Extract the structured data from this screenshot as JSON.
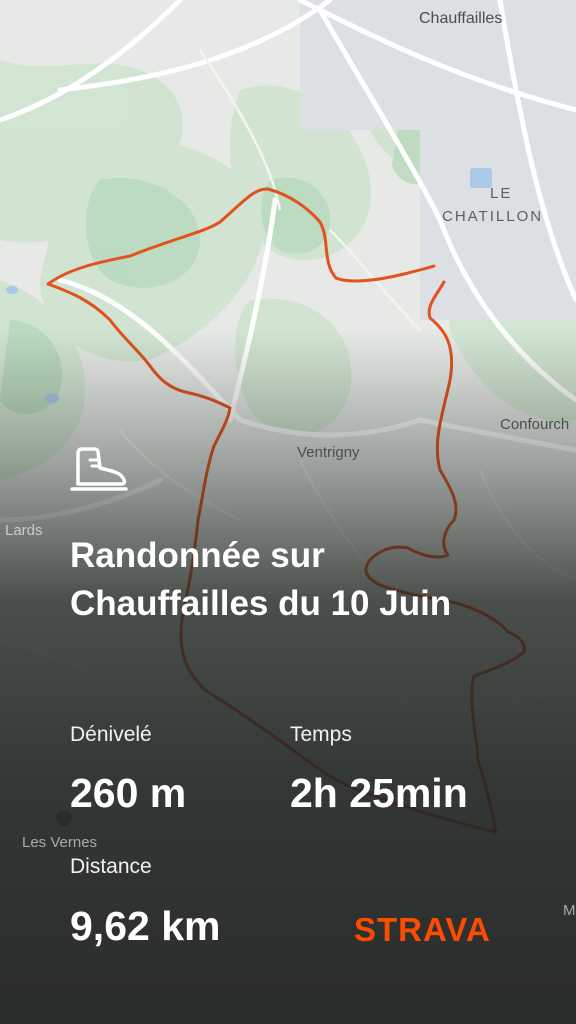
{
  "map": {
    "labels": {
      "chauffailles": "Chauffailles",
      "le": "LE",
      "chatillon": "CHATILLON",
      "ventrigny": "Ventrigny",
      "confourch": "Confourch",
      "lards": "Lards",
      "les_vernes": "Les Vernes",
      "m": "M"
    },
    "route_color": "#e2511e"
  },
  "card": {
    "activity_icon": "hiking-boot-icon",
    "title": "Randonnée sur Chauffailles du 10 Juin",
    "stats": {
      "elevation_label": "Dénivelé",
      "elevation_value": "260 m",
      "time_label": "Temps",
      "time_value": "2h 25min",
      "distance_label": "Distance",
      "distance_value": "9,62 km"
    },
    "brand": "STRAVA",
    "brand_color": "#fc4c02"
  }
}
